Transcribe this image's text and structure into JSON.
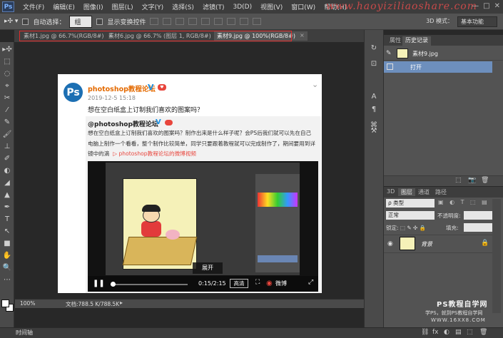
{
  "app": {
    "logo": "Ps",
    "menu": [
      "文件(F)",
      "编辑(E)",
      "图像(I)",
      "图层(L)",
      "文字(Y)",
      "选择(S)",
      "滤镜(T)",
      "3D(D)",
      "视图(V)",
      "窗口(W)",
      "帮助(H)"
    ],
    "watermark": "www.haoyiziliaoshare.com",
    "window_controls": [
      "—",
      "□",
      "✕"
    ]
  },
  "options_bar": {
    "auto_select_label": "自动选择：",
    "auto_select_value": "组",
    "show_transform_label": "显示变换控件",
    "mode_3d_label": "3D 模式：",
    "workspace": "基本功能"
  },
  "tabs": [
    {
      "label": "素材1.jpg @ 66.7%(RGB/8#)",
      "active": false
    },
    {
      "label": "素材6.jpg @ 66.7% (图层 1, RGB/8#)",
      "active": false
    },
    {
      "label": "素材9.jpg @ 100%(RGB/8#)",
      "active": true
    }
  ],
  "tab_close": "×",
  "tools": [
    "▸✣",
    "⬚",
    "◌",
    "⌖",
    "✂",
    "⁄",
    "✎",
    "🖌",
    "⊥",
    "✐",
    "◐",
    "◢",
    "▲",
    "✒",
    "T",
    "↖",
    "■",
    "✋",
    "🔍",
    "⋯"
  ],
  "post": {
    "avatar_text": "Ps",
    "author": "photoshop教程论坛",
    "verified_mark": "V",
    "heart": "♥",
    "date": "2019-12-5 15:18",
    "chevron": "⌄",
    "title": "想在空白纸盒上订制我们喜欢的图案吗？",
    "repost_author": "@photoshop教程论坛",
    "repost_lines": [
      "想在空白纸盒上订制我们喜欢的图案吗？制作出来是什么样子呢？会PS后我们就可以先在自己",
      "电脑上制作一个看看，整个制作比较简单，同学只要跟着教程就可以完成制作了，期间要用到详",
      "镜中的滴"
    ],
    "repost_link": "photoshop教程论坛的微博视频",
    "video": {
      "expand_label": "展开",
      "play_icon": "❚❚",
      "progress": 0.03,
      "time": "0:15/2:15",
      "quality": "高清",
      "fullscreen_icon": "⛶",
      "weibo_icon": "◉",
      "weibo_label": "微博",
      "more_icon": "⤢"
    }
  },
  "status": {
    "zoom": "100%",
    "doc_info": "文档:788.5 K/788.5K",
    "arrow": "▸",
    "timeline_tab": "时间轴"
  },
  "history": {
    "tabs": [
      "属性",
      "历史记录"
    ],
    "snapshot_label": "素材9.jpg",
    "step_label": "打开",
    "footer_icons": [
      "⬚",
      "📷",
      "🗑"
    ]
  },
  "layers": {
    "tabs": [
      "3D",
      "图层",
      "通道",
      "路径"
    ],
    "filter": "ρ 类型",
    "filter_icons": "▣ ◐ T ⬚ ▤",
    "blend_mode": "正常",
    "opacity_label": "不透明度:",
    "opacity_value": "",
    "lock_label": "锁定: ⬚ ✎ ✣ 🔒",
    "fill_label": "填充:",
    "fill_value": "",
    "layer_name": "背景",
    "eye_icon": "◉",
    "lock_icon": "🔒",
    "footer_icons": [
      "⛓",
      "fx",
      "◐",
      "▤",
      "⬚",
      "🗑"
    ]
  },
  "brand": {
    "line1": "PS教程自学网",
    "line2": "学PS，就到PS教程自学网",
    "line3": "WWW.16XX8.COM"
  },
  "dock_icons": [
    "↻",
    "⊡",
    "A",
    "¶",
    "⌘",
    "⚒"
  ],
  "colors": {
    "accent": "#6d8fbd",
    "tab_outline": "#e02a2a",
    "weibo_red": "#e8453c",
    "ps_blue": "#1c6fb3"
  }
}
